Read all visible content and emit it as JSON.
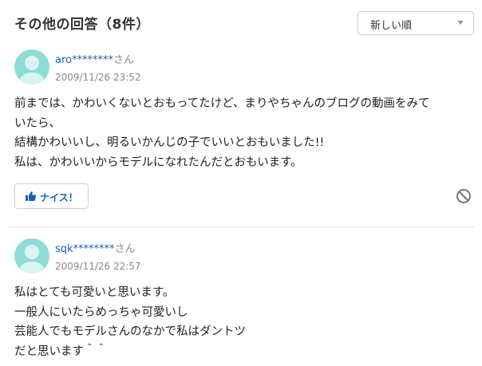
{
  "header": {
    "title": "その他の回答（8件）",
    "sort_selected": "新しい順"
  },
  "answers": [
    {
      "user_name": "aro********",
      "user_suffix": "さん",
      "date": "2009/11/26 23:52",
      "lines": [
        "前までは、かわいくないとおもってたけど、まりやちゃんのブログの動画をみて",
        "いたら、",
        "結構かわいいし、明るいかんじの子でいいとおもいました!!",
        "私は、かわいいからモデルになれたんだとおもいます。"
      ],
      "nice_label": "ナイス！"
    },
    {
      "user_name": "sqk********",
      "user_suffix": "さん",
      "date": "2009/11/26 22:57",
      "lines": [
        "私はとても可愛いと思います。",
        "一般人にいたらめっちゃ可愛いし",
        "芸能人でもモデルさんのなかで私はダントツ",
        "だと思います＾＾"
      ]
    }
  ],
  "colors": {
    "link": "#1a5fb4",
    "avatar": "#8fdcd6",
    "muted": "#888888"
  }
}
